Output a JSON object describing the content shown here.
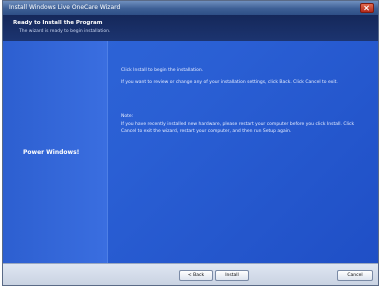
{
  "window": {
    "title": "Install Windows Live OneCare Wizard"
  },
  "header": {
    "title": "Ready to Install the Program",
    "subtitle": "The wizard is ready to begin installation."
  },
  "sidebar": {
    "label": "Power Windows!"
  },
  "content": {
    "line1": "Click Install to begin the installation.",
    "line2": "If you want to review or change any of your installation settings, click Back. Click Cancel to exit.",
    "line3": "Note:",
    "line4": "If you have recently installed new hardware, please restart your computer before you click Install. Click",
    "line5": "Cancel to exit the wizard, restart your computer, and then run Setup again."
  },
  "buttons": {
    "back": "< Back",
    "next": "Install",
    "cancel": "Cancel"
  },
  "colors": {
    "header_bg": "#15285a",
    "content_bg": "#2a5fd4",
    "footer_bg": "#d6dde9"
  }
}
